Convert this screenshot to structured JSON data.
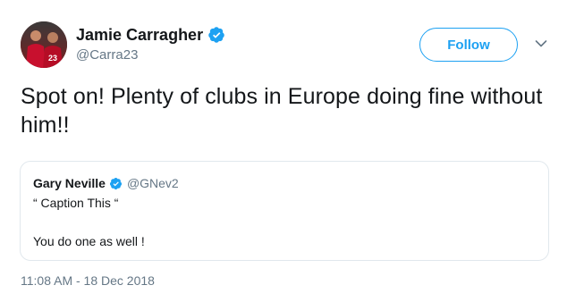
{
  "author": {
    "display_name": "Jamie Carragher",
    "handle": "@Carra23",
    "avatar_label": "23"
  },
  "follow_button": {
    "label": "Follow"
  },
  "tweet": {
    "text": "Spot on! Plenty of clubs in Europe doing fine without him!!",
    "timestamp": "11:08 AM - 18 Dec 2018"
  },
  "quoted_tweet": {
    "display_name": "Gary Neville",
    "handle": "@GNev2",
    "line1": "“ Caption This “",
    "line2": "You do one as well !"
  },
  "icons": {
    "verified": "verified-badge-icon",
    "caret": "chevron-down-icon"
  },
  "colors": {
    "accent": "#1da1f2",
    "muted": "#657786",
    "border": "#e1e8ed",
    "text": "#14171a"
  }
}
